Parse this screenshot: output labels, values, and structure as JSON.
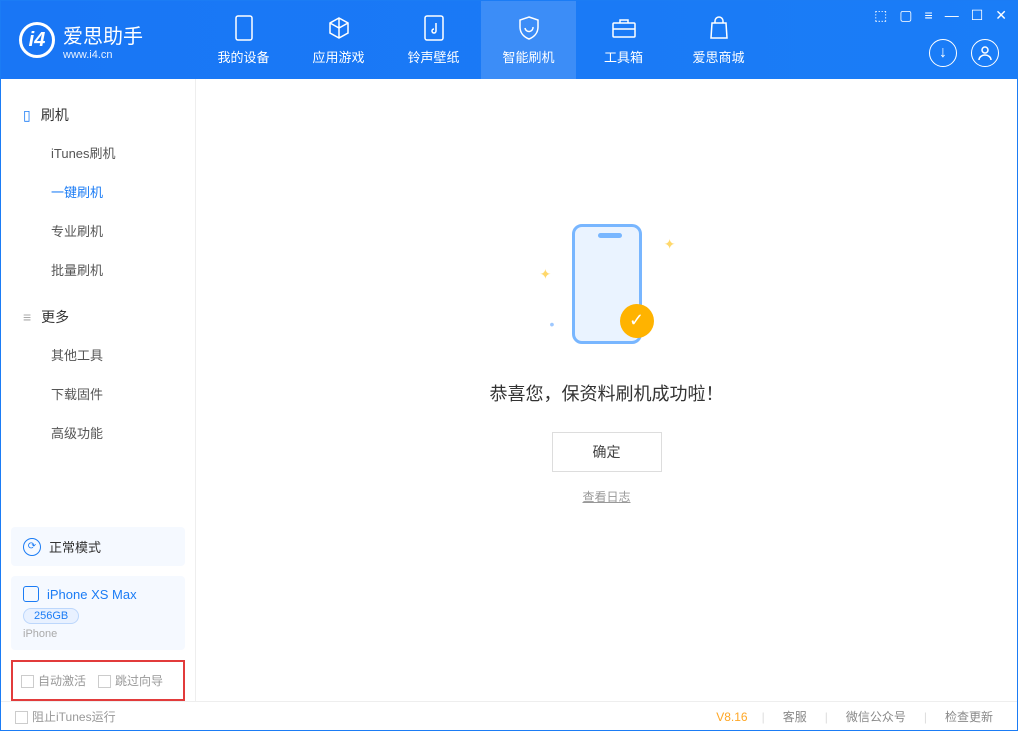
{
  "header": {
    "app_name": "爱思助手",
    "app_site": "www.i4.cn",
    "tabs": [
      {
        "label": "我的设备"
      },
      {
        "label": "应用游戏"
      },
      {
        "label": "铃声壁纸"
      },
      {
        "label": "智能刷机"
      },
      {
        "label": "工具箱"
      },
      {
        "label": "爱思商城"
      }
    ]
  },
  "sidebar": {
    "group1_title": "刷机",
    "group1_items": [
      "iTunes刷机",
      "一键刷机",
      "专业刷机",
      "批量刷机"
    ],
    "group2_title": "更多",
    "group2_items": [
      "其他工具",
      "下载固件",
      "高级功能"
    ],
    "mode_label": "正常模式",
    "device_name": "iPhone XS Max",
    "device_capacity": "256GB",
    "device_type": "iPhone",
    "opt_auto_activate": "自动激活",
    "opt_skip_guide": "跳过向导"
  },
  "main": {
    "success_msg": "恭喜您，保资料刷机成功啦！",
    "ok_label": "确定",
    "log_label": "查看日志"
  },
  "footer": {
    "block_itunes": "阻止iTunes运行",
    "version": "V8.16",
    "links": [
      "客服",
      "微信公众号",
      "检查更新"
    ]
  }
}
